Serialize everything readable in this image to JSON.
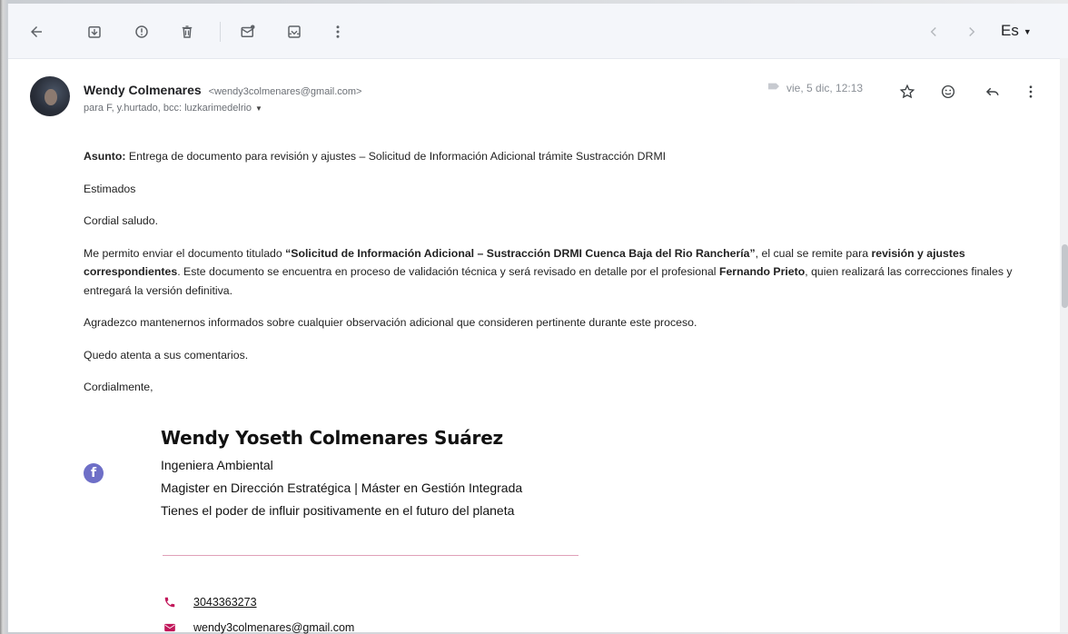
{
  "toolbar": {
    "language": "Es"
  },
  "email": {
    "sender_name": "Wendy Colmenares",
    "sender_email": "<wendy3colmenares@gmail.com>",
    "recipients": "para F, y.hurtado, bcc: luzkarimedelrio",
    "date": "vie, 5 dic, 12:13"
  },
  "body": {
    "subject_label": "Asunto:",
    "subject_text": " Entrega de documento para revisión y ajustes – Solicitud de Información Adicional trámite Sustracción DRMI",
    "greeting": "Estimados",
    "salutation": "Cordial saludo.",
    "p1_a": "Me permito enviar el documento titulado ",
    "p1_title": "“Solicitud de Información Adicional – Sustracción DRMI Cuenca Baja del Rio Ranchería”",
    "p1_b": ", el cual se remite para ",
    "p1_bold2": "revisión y ajustes correspondientes",
    "p1_c": ". Este documento se encuentra en proceso de validación técnica y será revisado en detalle por el profesional ",
    "p1_person": "Fernando Prieto",
    "p1_d": ", quien realizará las correcciones finales y entregará la versión definitiva.",
    "p2": "Agradezco mantenernos informados sobre cualquier observación adicional que consideren pertinente durante este proceso.",
    "p3": "Quedo atenta a sus comentarios.",
    "closing": "Cordialmente,"
  },
  "signature": {
    "name": "Wendy Yoseth Colmenares Suárez",
    "title": "Ingeniera Ambiental",
    "degrees": "Magister en Dirección Estratégica | Máster en Gestión Integrada",
    "motto": "Tienes el poder de influir positivamente en el futuro del planeta",
    "phone": "3043363273",
    "email": "wendy3colmenares@gmail.com"
  },
  "colors": {
    "facebook": "#6e6fc7",
    "contact_icon": "#c2185b",
    "divider": "#e0a0b8"
  },
  "icons": [
    "back-arrow-icon",
    "archive-icon",
    "report-spam-icon",
    "delete-icon",
    "mark-unread-icon",
    "move-to-icon",
    "more-vert-icon",
    "prev-icon",
    "next-icon",
    "label-icon",
    "star-icon",
    "emoji-icon",
    "reply-icon",
    "facebook-icon",
    "phone-icon",
    "mail-icon"
  ]
}
